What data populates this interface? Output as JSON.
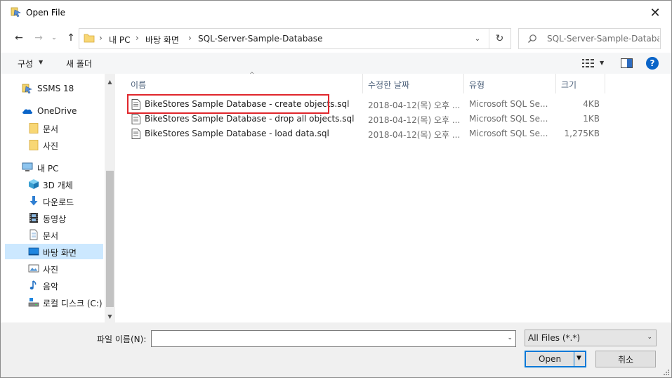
{
  "window": {
    "title": "Open File",
    "close_symbol": "✕",
    "title_icon": "ssms-icon"
  },
  "nav": {
    "back_symbol": "←",
    "forward_symbol": "→",
    "recent_symbol": "⌄",
    "up_symbol": "↑",
    "breadcrumb_separator": "›",
    "breadcrumbs": [
      "내 PC",
      "바탕 화면",
      "SQL-Server-Sample-Database"
    ],
    "address_dropdown_symbol": "⌄",
    "refresh_symbol": "↻",
    "search_placeholder": "SQL-Server-Sample-Databa..."
  },
  "toolbar": {
    "organize_label": "구성",
    "organize_arrow": "▼",
    "new_folder_label": "새 폴더",
    "view_arrow": "▼",
    "help_label": "?"
  },
  "sidebar": {
    "scroll_up_symbol": "▲",
    "scroll_down_symbol": "▼",
    "items": [
      {
        "label": "SSMS 18",
        "icon": "ssms-icon"
      },
      {
        "label": "OneDrive",
        "icon": "cloud-icon"
      },
      {
        "label": "문서",
        "icon": "folder-icon"
      },
      {
        "label": "사진",
        "icon": "folder-icon"
      },
      {
        "label": "내 PC",
        "icon": "computer-icon"
      },
      {
        "label": "3D 개체",
        "icon": "cube-icon"
      },
      {
        "label": "다운로드",
        "icon": "download-icon"
      },
      {
        "label": "동영상",
        "icon": "film-icon"
      },
      {
        "label": "문서",
        "icon": "document-icon"
      },
      {
        "label": "바탕 화면",
        "icon": "desktop-icon"
      },
      {
        "label": "사진",
        "icon": "pictures-icon"
      },
      {
        "label": "음악",
        "icon": "music-icon"
      },
      {
        "label": "로컬 디스크 (C:)",
        "icon": "drive-icon"
      }
    ]
  },
  "filelist": {
    "sort_symbol": "^",
    "columns": {
      "name": "이름",
      "date": "수정한 날짜",
      "type": "유형",
      "size": "크기"
    },
    "files": [
      {
        "name": "BikeStores Sample Database - create objects.sql",
        "date": "2018-04-12(목) 오후 ...",
        "type": "Microsoft SQL Se...",
        "size": "4KB"
      },
      {
        "name": "BikeStores Sample Database - drop all objects.sql",
        "date": "2018-04-12(목) 오후 ...",
        "type": "Microsoft SQL Se...",
        "size": "1KB"
      },
      {
        "name": "BikeStores Sample Database - load data.sql",
        "date": "2018-04-12(목) 오후 ...",
        "type": "Microsoft SQL Se...",
        "size": "1,275KB"
      }
    ]
  },
  "bottom": {
    "filename_label": "파일 이름(N):",
    "filename_value": "",
    "filename_dropdown_symbol": "⌄",
    "filter_value": "All Files (*.*)",
    "filter_arrow": "⌄",
    "open_label": "Open",
    "open_arrow": "▼",
    "cancel_label": "취소"
  },
  "colors": {
    "selection_highlight": "#cce8ff",
    "annotation_box": "#e0262c",
    "default_button_border": "#0078d7",
    "folder_yellow": "#f8d775"
  }
}
